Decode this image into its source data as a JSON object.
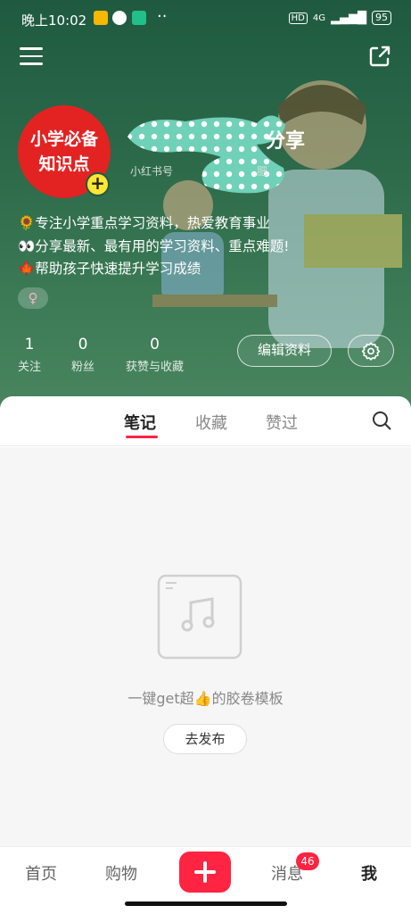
{
  "status_bar": {
    "time": "晚上10:02",
    "signal": "4G",
    "battery": "95",
    "dots": "··"
  },
  "profile": {
    "avatar_line1": "小学必备",
    "avatar_line2": "知识点",
    "avatar_plus": "+",
    "name_suffix": "分享",
    "id_prefix": "小红书号",
    "id_tail": "肥",
    "bio": [
      "🌻专注小学重点学习资料，热爱教育事业",
      "👀分享最新、最有用的学习资料、重点难题!",
      "🍁帮助孩子快速提升学习成绩"
    ],
    "gender_symbol": "♀"
  },
  "stats": [
    {
      "num": "1",
      "label": "关注"
    },
    {
      "num": "0",
      "label": "粉丝"
    },
    {
      "num": "0",
      "label": "获赞与收藏"
    }
  ],
  "actions": {
    "edit_label": "编辑资料"
  },
  "tabs": [
    {
      "label": "笔记"
    },
    {
      "label": "收藏"
    },
    {
      "label": "赞过"
    }
  ],
  "empty_state": {
    "text": "一键get超👍的胶卷模板",
    "button": "去发布"
  },
  "bottom_nav": {
    "home": "首页",
    "shop": "购物",
    "messages": "消息",
    "messages_badge": "46",
    "me": "我"
  },
  "colors": {
    "accent": "#ff2442",
    "header_green": "#2d6a4a",
    "avatar_red": "#e32222",
    "plus_yellow": "#ffe633"
  }
}
